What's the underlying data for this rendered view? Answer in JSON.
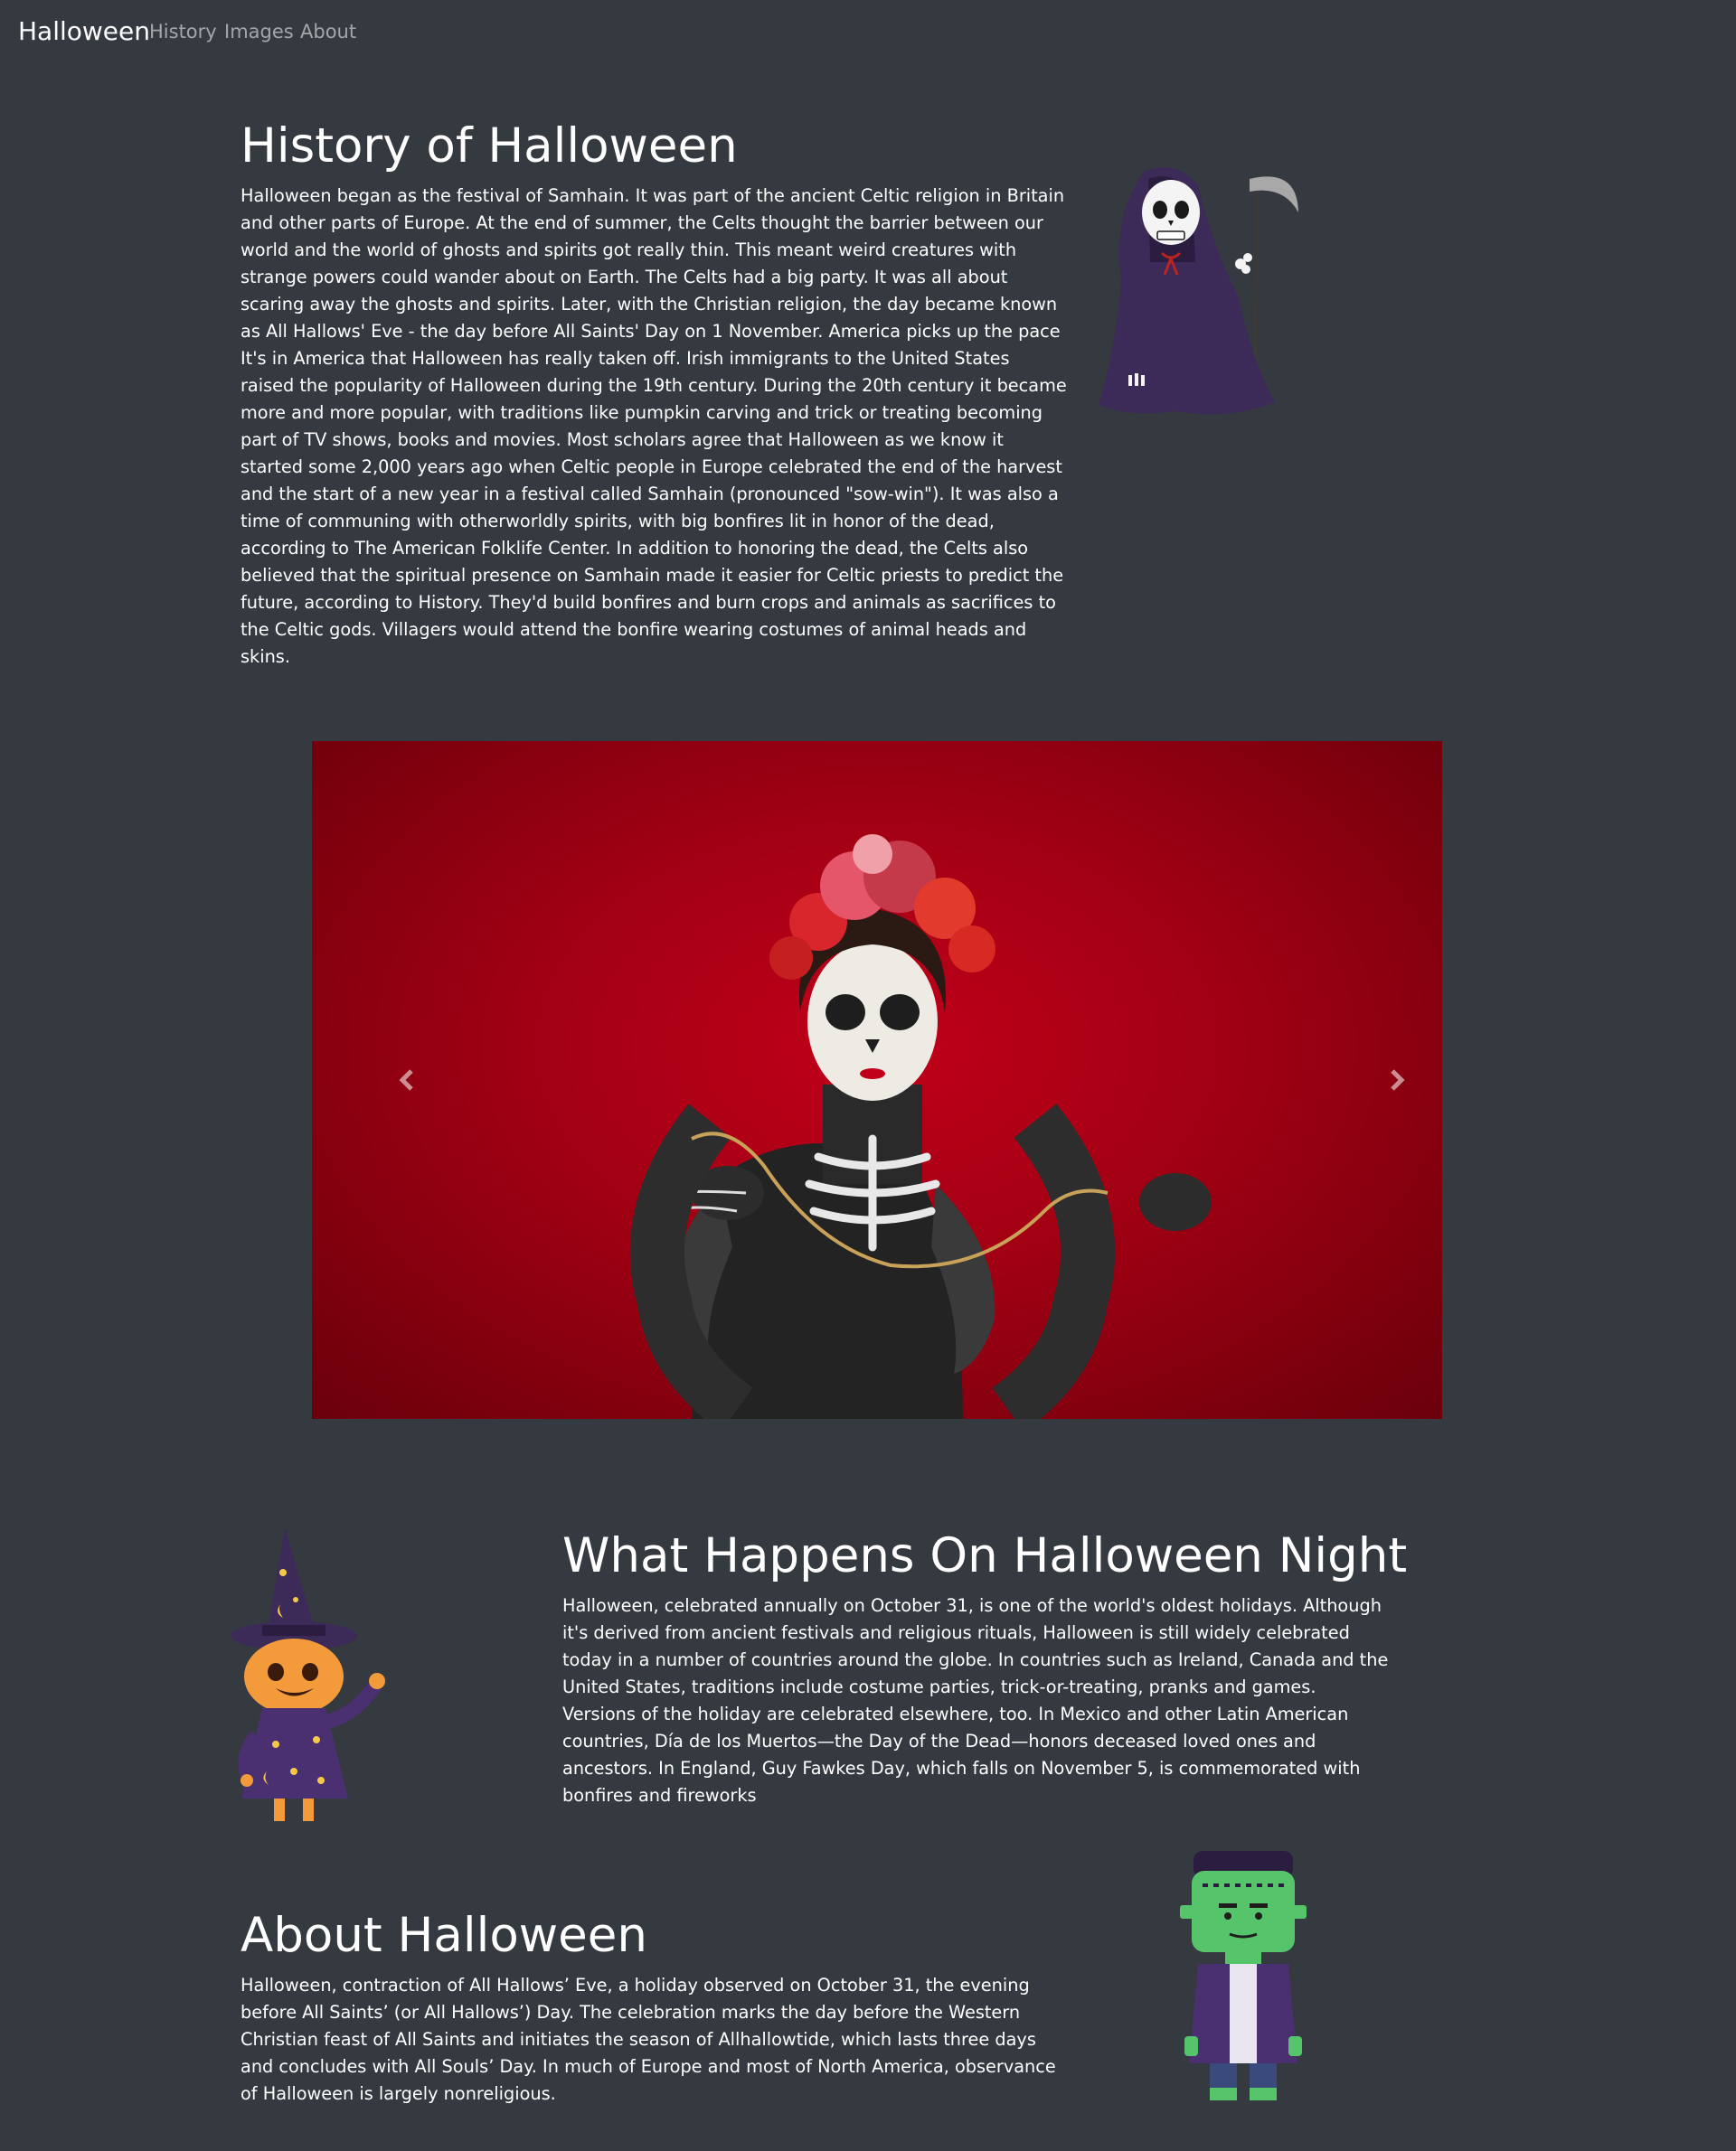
{
  "navbar": {
    "brand": "Halloween",
    "links": [
      "History",
      "Images",
      "About"
    ]
  },
  "history": {
    "title": "History of Halloween",
    "text": "Halloween began as the festival of Samhain. It was part of the ancient Celtic religion in Britain and other parts of Europe. At the end of summer, the Celts thought the barrier between our world and the world of ghosts and spirits got really thin. This meant weird creatures with strange powers could wander about on Earth. The Celts had a big party. It was all about scaring away the ghosts and spirits. Later, with the Christian religion, the day became known as All Hallows' Eve - the day before All Saints' Day on 1 November. America picks up the pace It's in America that Halloween has really taken off. Irish immigrants to the United States raised the popularity of Halloween during the 19th century. During the 20th century it became more and more popular, with traditions like pumpkin carving and trick or treating becoming part of TV shows, books and movies. Most scholars agree that Halloween as we know it started some 2,000 years ago when Celtic people in Europe celebrated the end of the harvest and the start of a new year in a festival called Samhain (pronounced \"sow-win\"). It was also a time of communing with otherworldly spirits, with big bonfires lit in honor of the dead, according to The American Folklife Center. In addition to honoring the dead, the Celts also believed that the spiritual presence on Samhain made it easier for Celtic priests to predict the future, according to History. They'd build bonfires and burn crops and animals as sacrifices to the Celtic gods. Villagers would attend the bonfire wearing costumes of animal heads and skins."
  },
  "carousel": {
    "prev_icon": "chevron-left-icon",
    "next_icon": "chevron-right-icon"
  },
  "night": {
    "title": "What Happens On Halloween Night",
    "text": "Halloween, celebrated annually on October 31, is one of the world's oldest holidays. Although it's derived from ancient festivals and religious rituals, Halloween is still widely celebrated today in a number of countries around the globe. In countries such as Ireland, Canada and the United States, traditions include costume parties, trick-or-treating, pranks and games. Versions of the holiday are celebrated elsewhere, too. In Mexico and other Latin American countries, Día de los Muertos—the Day of the Dead—honors deceased loved ones and ancestors. In England, Guy Fawkes Day, which falls on November 5, is commemorated with bonfires and fireworks"
  },
  "about": {
    "title": "About Halloween",
    "text": "Halloween, contraction of All Hallows’ Eve, a holiday observed on October 31, the evening before All Saints’ (or All Hallows’) Day. The celebration marks the day before the Western Christian feast of All Saints and initiates the season of Allhallowtide, which lasts three days and concludes with All Souls’ Day. In much of Europe and most of North America, observance of Halloween is largely nonreligious."
  },
  "colors": {
    "background": "#343a40",
    "carousel_red": "#a00013",
    "nav_muted": "rgba(255,255,255,0.55)"
  }
}
